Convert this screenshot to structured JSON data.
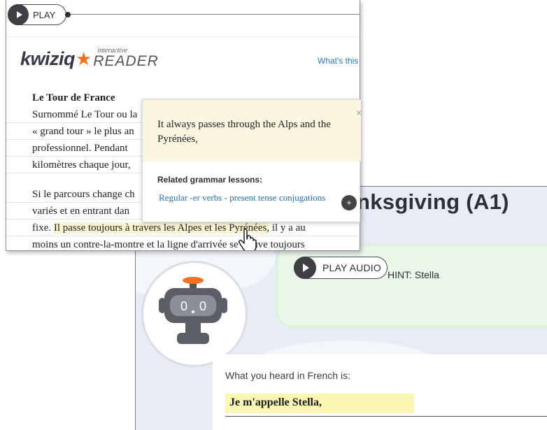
{
  "back_panel": {
    "title": "nksgiving (A1)",
    "play_audio_label": "PLAY AUDIO",
    "hint": "HINT: Stella",
    "heard_label": "What you heard in French is:",
    "answer": "Je m'appelle Stella,"
  },
  "reader": {
    "play_label": "PLAY",
    "logo_brand": "kwiziq",
    "logo_sub_small": "interactive",
    "logo_sub_large": "READER",
    "whats_this": "What's this",
    "heading": "Le Tour de France",
    "lines": [
      "Surnommé Le Tour ou la",
      "« grand tour » le plus an",
      "professionnel.  Pendant",
      "kilomètres chaque jour,"
    ],
    "para2_line1": "Si le parcours change ch",
    "para2_line2": "variés  et en entrant dan",
    "para2_line3_pre": "fixe.",
    "para2_line3_highlight": "Il passe toujours à travers les Alpes et les Pyrénées,",
    "para2_line3_post": " il y a au",
    "para2_line4": "moins un contre-la-montre et la ligne d'arrivée se trouve toujours"
  },
  "popup": {
    "sentence": "It always passes through the Alps and the Pyrénées,",
    "close": "×",
    "related_label": "Related grammar lessons:",
    "lesson_link": "Regular -er verbs - present tense conjugations"
  },
  "colors": {
    "highlight": "#fbf4d3",
    "answer_highlight": "#fbf7b3",
    "logo_star": "#f36f21",
    "link": "#2a6fb0"
  }
}
